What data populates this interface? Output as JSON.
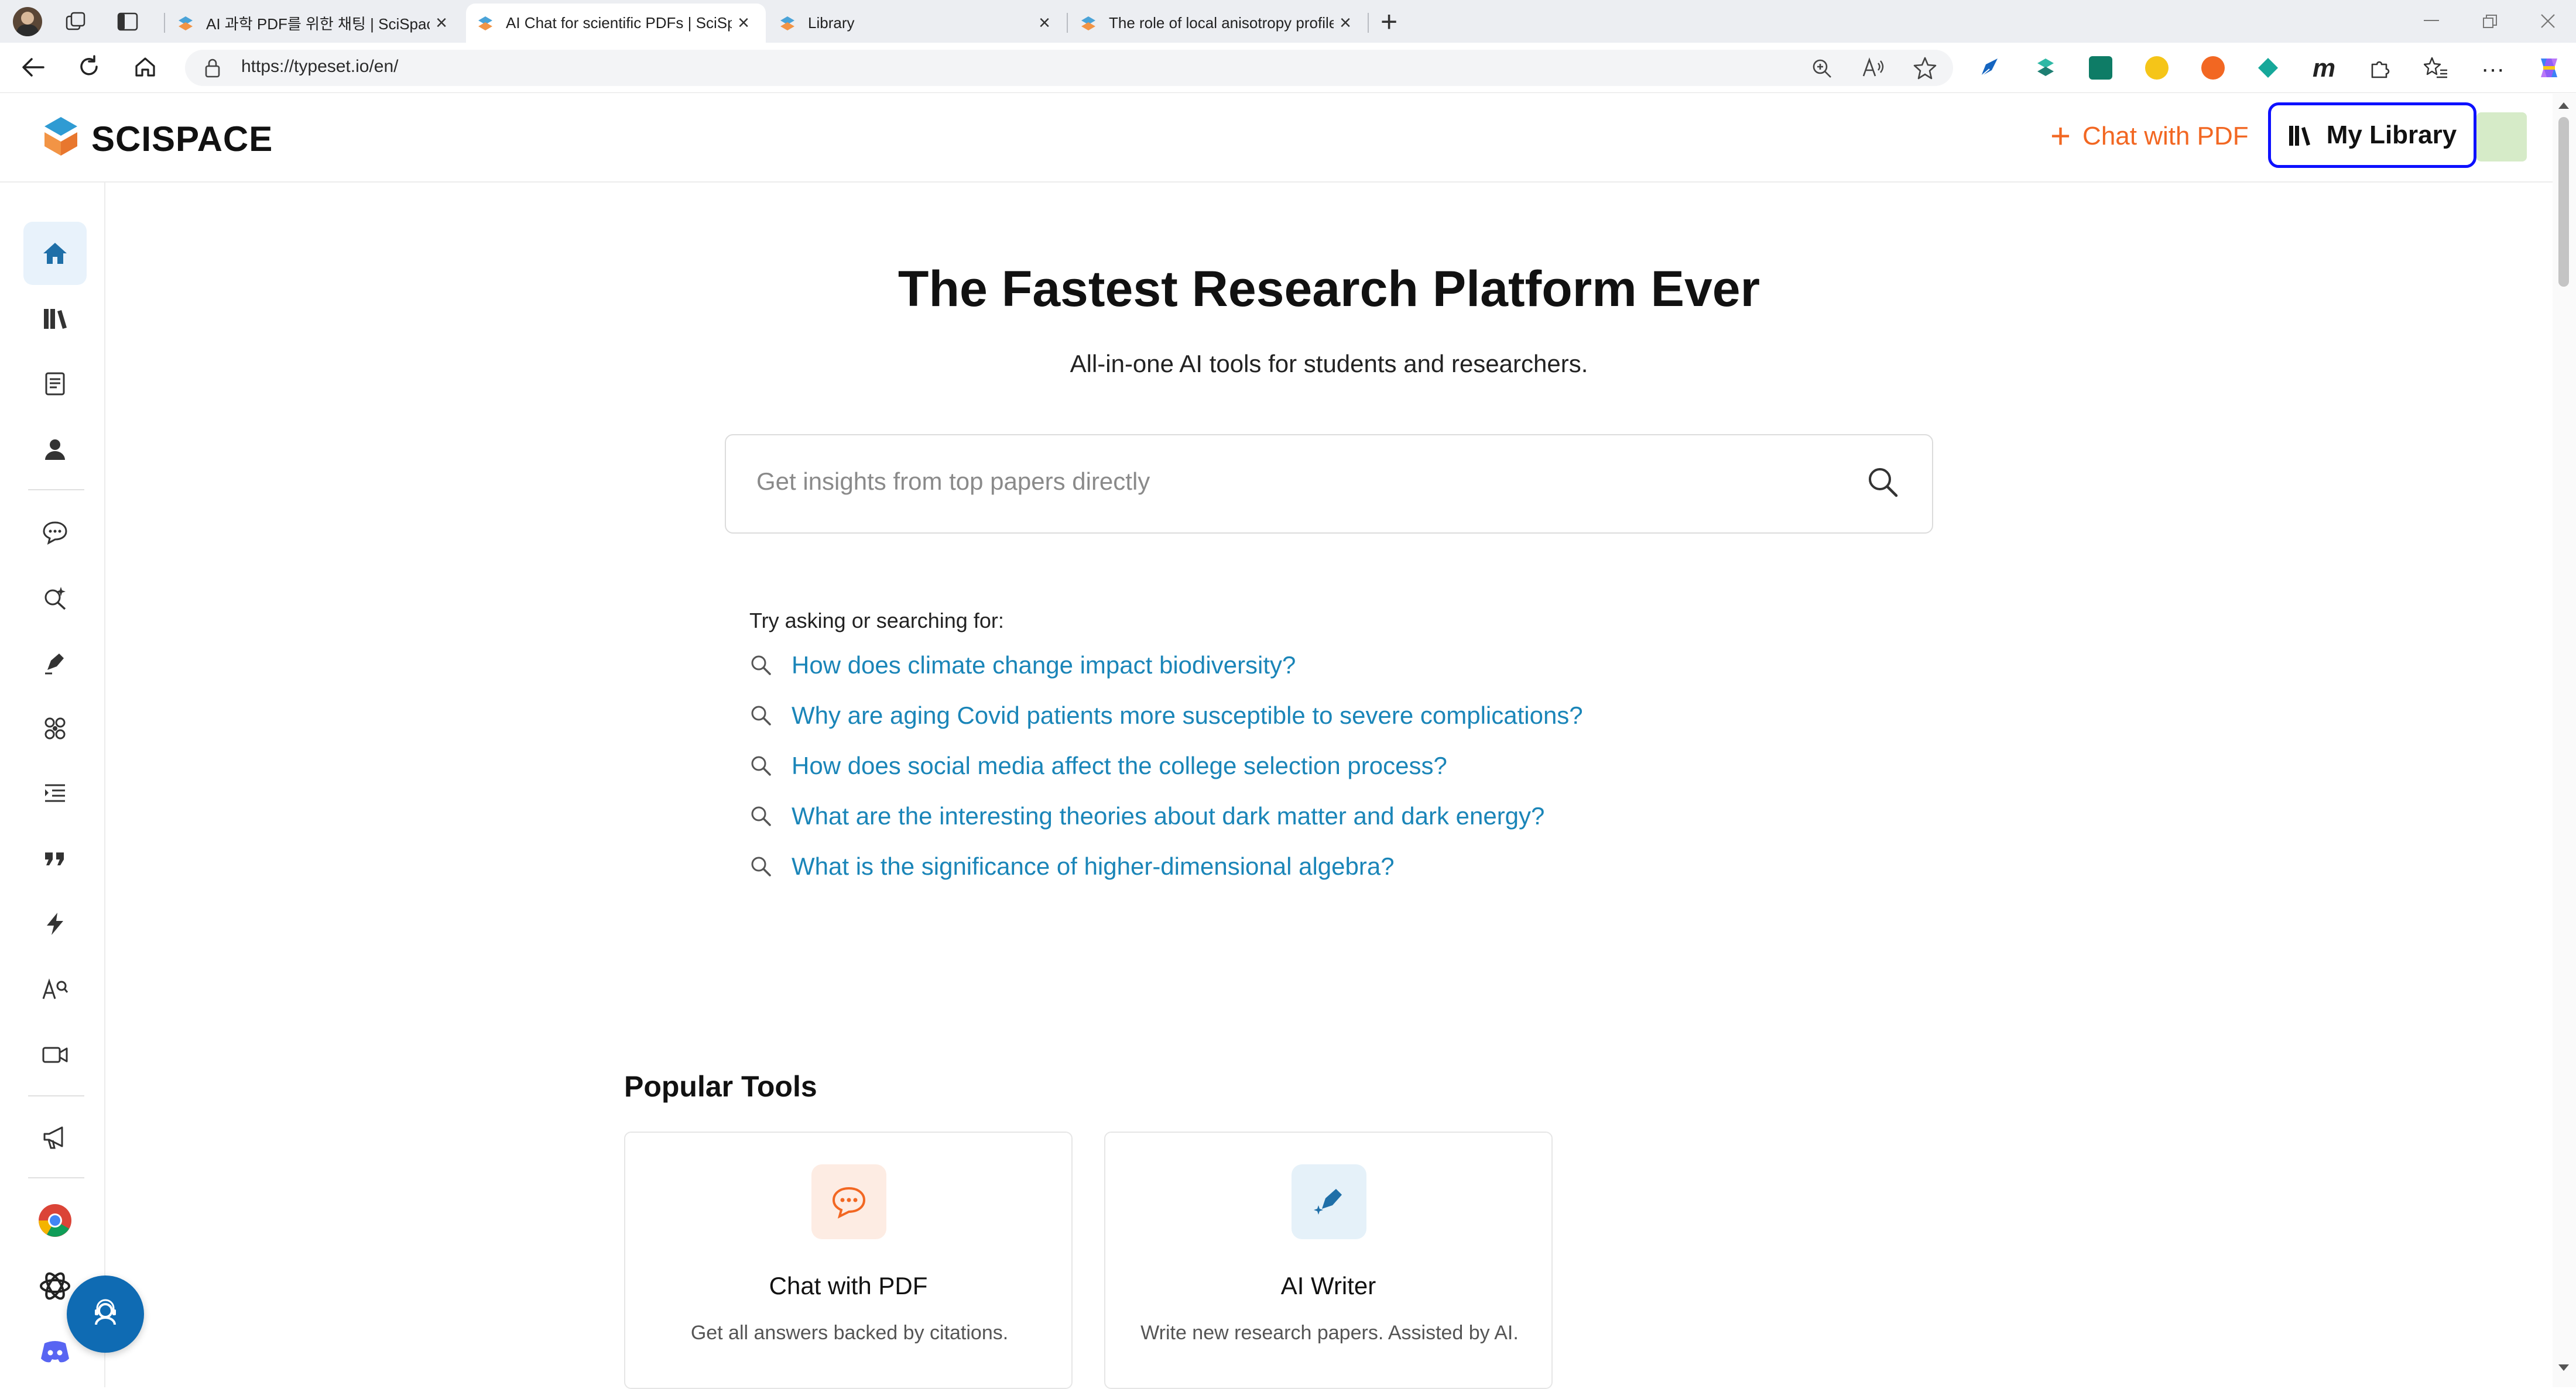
{
  "browser": {
    "tabs": [
      {
        "title": "AI 과학 PDF를 위한 채팅 | SciSpace",
        "active": false
      },
      {
        "title": "AI Chat for scientific PDFs | SciSpace",
        "active": true
      },
      {
        "title": "Library",
        "active": false
      },
      {
        "title": "The role of local anisotropy profiles",
        "active": false
      }
    ],
    "new_tab_label": "+",
    "close_label": "×",
    "url": "https://typeset.io/en/"
  },
  "header": {
    "brand": "SCISPACE",
    "chat_with_pdf": "Chat with PDF",
    "my_library": "My Library"
  },
  "sidebar": {
    "items": [
      {
        "icon": "home-icon",
        "active": true
      },
      {
        "icon": "library-icon",
        "active": false
      },
      {
        "icon": "notebook-icon",
        "active": false
      },
      {
        "icon": "profile-icon",
        "active": false
      },
      {
        "icon": "chat-icon",
        "active": false
      },
      {
        "icon": "literature-search-icon",
        "active": false
      },
      {
        "icon": "ai-writer-pen-icon",
        "active": false
      },
      {
        "icon": "extract-data-icon",
        "active": false
      },
      {
        "icon": "paraphraser-icon",
        "active": false
      },
      {
        "icon": "citation-quote-icon",
        "active": false
      },
      {
        "icon": "lightning-icon",
        "active": false
      },
      {
        "icon": "ai-detector-icon",
        "active": false
      },
      {
        "icon": "video-icon",
        "active": false
      },
      {
        "icon": "megaphone-icon",
        "active": false
      },
      {
        "icon": "chrome-extension-icon",
        "active": false
      },
      {
        "icon": "openai-gpt-icon",
        "active": false
      },
      {
        "icon": "discord-icon",
        "active": false
      }
    ]
  },
  "hero": {
    "title": "The Fastest Research Platform Ever",
    "subtitle": "All-in-one AI tools for students and researchers.",
    "search_placeholder": "Get insights from top papers directly"
  },
  "suggestions": {
    "label": "Try asking or searching for:",
    "items": [
      "How does climate change impact biodiversity?",
      "Why are aging Covid patients more susceptible to severe complications?",
      "How does social media affect the college selection process?",
      "What are the interesting theories about dark matter and dark energy?",
      "What is the significance of higher-dimensional algebra?"
    ]
  },
  "popular_tools": {
    "heading": "Popular Tools",
    "cards": [
      {
        "title": "Chat with PDF",
        "desc": "Get all answers backed by citations.",
        "icon": "chat-bubble-icon"
      },
      {
        "title": "AI Writer",
        "desc": "Write new research papers. Assisted by AI.",
        "icon": "pen-sparkle-icon"
      }
    ]
  },
  "colors": {
    "accent_orange": "#f26722",
    "link_blue": "#1a85b8",
    "highlight_border": "#0d10ff",
    "fab_blue": "#0f6bb3"
  }
}
